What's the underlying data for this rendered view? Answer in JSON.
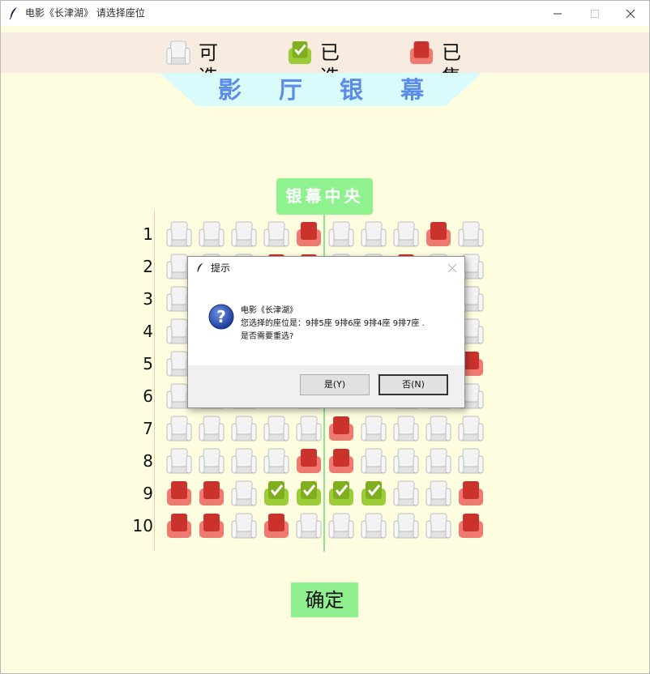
{
  "window": {
    "title": "电影《长津湖》 请选择座位"
  },
  "legend": {
    "available": "可选",
    "selected": "已选",
    "sold": "已售"
  },
  "screen": {
    "title": "影 厅 银 幕"
  },
  "center_label": "银幕中央",
  "rows": [
    "1",
    "2",
    "3",
    "4",
    "5",
    "6",
    "7",
    "8",
    "9",
    "10"
  ],
  "seats": [
    [
      "a",
      "a",
      "a",
      "a",
      "s",
      "a",
      "a",
      "a",
      "s",
      "a"
    ],
    [
      "a",
      "a",
      "a",
      "s",
      "s",
      "a",
      "a",
      "s",
      "a",
      "a"
    ],
    [
      "a",
      "a",
      "a",
      "a",
      "a",
      "a",
      "a",
      "a",
      "a",
      "a"
    ],
    [
      "a",
      "a",
      "a",
      "a",
      "a",
      "a",
      "a",
      "a",
      "a",
      "a"
    ],
    [
      "a",
      "a",
      "a",
      "a",
      "a",
      "a",
      "a",
      "a",
      "a",
      "s"
    ],
    [
      "a",
      "a",
      "a",
      "s",
      "a",
      "s",
      "s",
      "a",
      "a",
      "a"
    ],
    [
      "a",
      "a",
      "a",
      "a",
      "a",
      "s",
      "a",
      "a",
      "a",
      "a"
    ],
    [
      "a",
      "a",
      "a",
      "a",
      "s",
      "s",
      "a",
      "a",
      "a",
      "a"
    ],
    [
      "s",
      "s",
      "a",
      "c",
      "c",
      "c",
      "c",
      "a",
      "a",
      "s"
    ],
    [
      "s",
      "s",
      "a",
      "s",
      "a",
      "a",
      "a",
      "a",
      "a",
      "s"
    ]
  ],
  "confirm_label": "确定",
  "dialog": {
    "title": "提示",
    "line1": "电影《长津湖》",
    "line2": "您选择的座位是：9排5座 9排6座 9排4座 9排7座 .",
    "line3": "是否需要重选?",
    "yes_label": "是(Y)",
    "no_label": "否(N)"
  },
  "colors": {
    "available": "#efefef",
    "selected": "#8bbd2b",
    "sold": "#d23a33",
    "background": "#fefde0",
    "legend_bg": "#f8ece0",
    "screen_bg": "#d9fbfb",
    "screen_text": "#5b8de8",
    "accent_green": "#8ff28f"
  }
}
